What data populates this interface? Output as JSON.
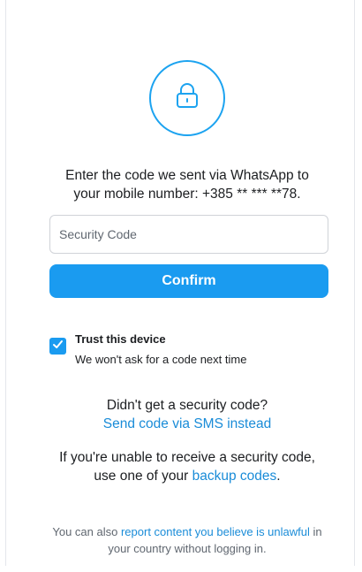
{
  "prompt": {
    "line1": "Enter the code we sent via WhatsApp to",
    "line2": "your mobile number: +385 ** *** **78."
  },
  "security_code": {
    "value": "",
    "placeholder": "Security Code"
  },
  "confirm_label": "Confirm",
  "trust": {
    "checked": true,
    "title": "Trust this device",
    "subtitle": "We won't ask for a code next time"
  },
  "resend": {
    "question": "Didn't get a security code?",
    "sms_link": "Send code via SMS instead"
  },
  "backup": {
    "line1": "If you're unable to receive a security code,",
    "line2_prefix": "use one of your ",
    "link": "backup codes",
    "line2_suffix": "."
  },
  "footer": {
    "prefix": "You can also ",
    "link": "report content you believe is unlawful",
    "suffix": " in",
    "line2": "your country without logging in."
  },
  "icons": {
    "lock": "lock-icon",
    "check": "check-icon"
  },
  "colors": {
    "accent": "#1a9bf0",
    "link": "#1a8cd8",
    "lock_ring": "#1ca3f0"
  }
}
